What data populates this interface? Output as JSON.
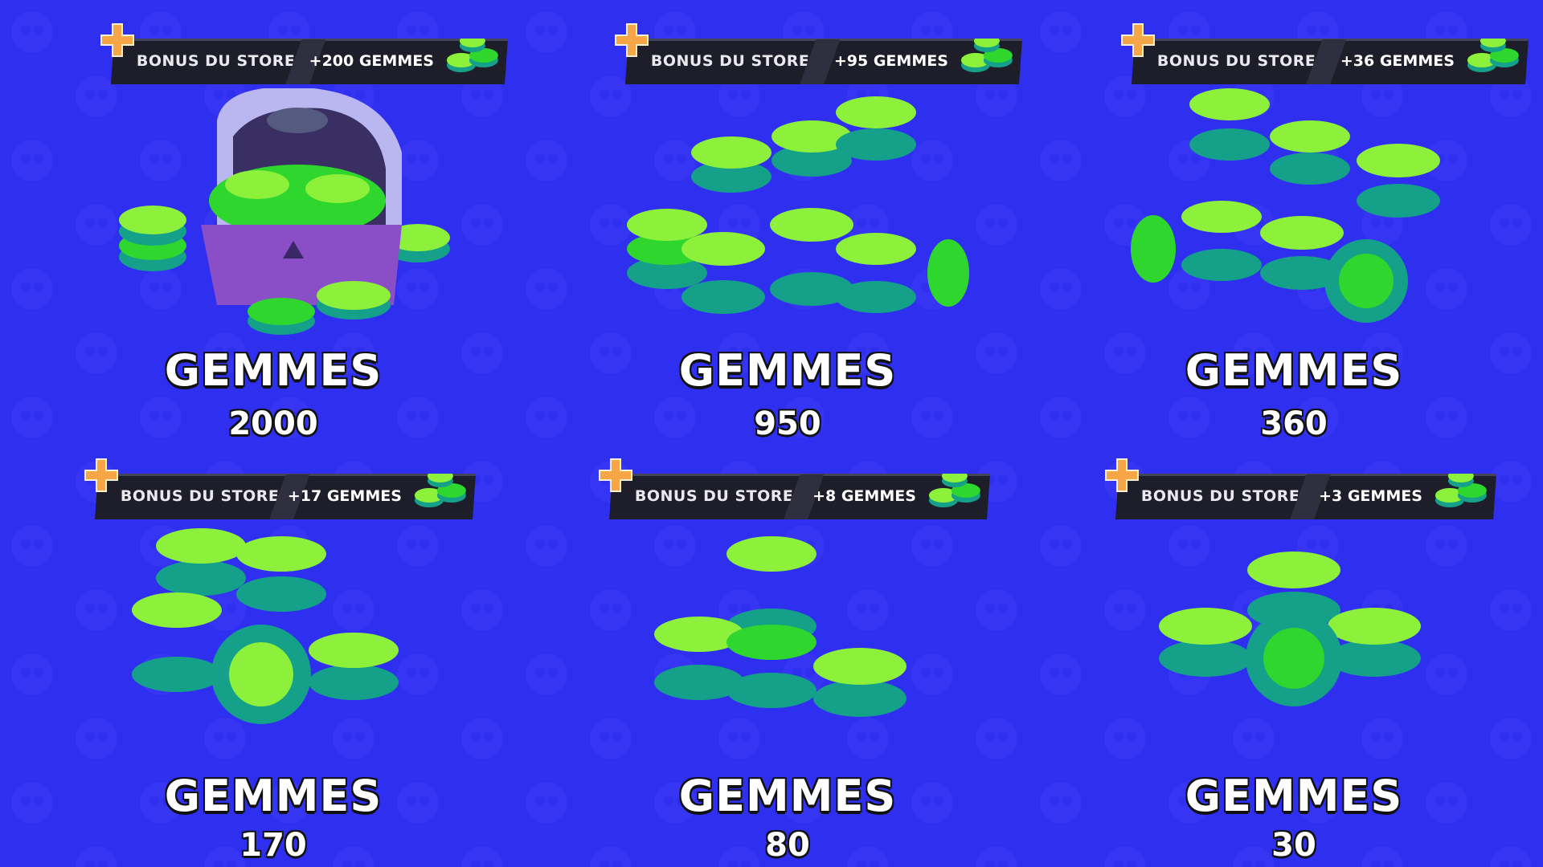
{
  "colors": {
    "background": "#2f2ff0",
    "gem_light": "#8df03a",
    "gem_mid": "#2ed62e",
    "gem_dark": "#15a08a",
    "banner_bg": "#1e1e2a",
    "plus": "#f6a646"
  },
  "icons": {
    "plus": "plus-icon",
    "mini_gems": "gem-stack-icon",
    "chest": "gem-chest-icon"
  },
  "offers": [
    {
      "bonus_label": "BONUS DU STORE",
      "bonus_value": "+200 GEMMES",
      "title": "GEMMES",
      "count": "2000",
      "has_chest": true
    },
    {
      "bonus_label": "BONUS DU STORE",
      "bonus_value": "+95 GEMMES",
      "title": "GEMMES",
      "count": "950",
      "has_chest": false
    },
    {
      "bonus_label": "BONUS DU STORE",
      "bonus_value": "+36 GEMMES",
      "title": "GEMMES",
      "count": "360",
      "has_chest": false
    },
    {
      "bonus_label": "BONUS DU STORE",
      "bonus_value": "+17 GEMMES",
      "title": "GEMMES",
      "count": "170",
      "has_chest": false
    },
    {
      "bonus_label": "BONUS DU STORE",
      "bonus_value": "+8 GEMMES",
      "title": "GEMMES",
      "count": "80",
      "has_chest": false
    },
    {
      "bonus_label": "BONUS DU STORE",
      "bonus_value": "+3 GEMMES",
      "title": "GEMMES",
      "count": "30",
      "has_chest": false
    }
  ]
}
